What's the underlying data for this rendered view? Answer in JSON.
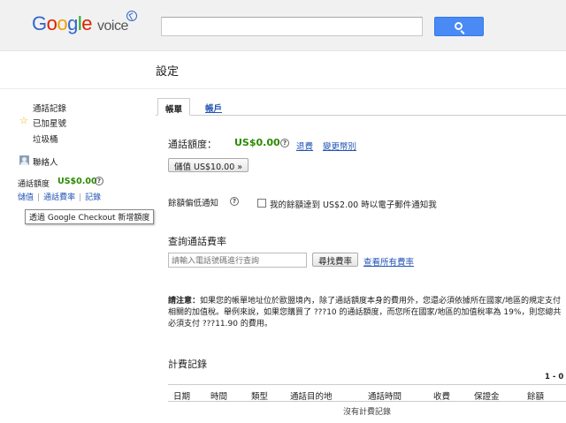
{
  "header": {
    "logo_letters": [
      "G",
      "o",
      "o",
      "g",
      "l",
      "e"
    ],
    "logo_suffix": "voice",
    "search_placeholder": ""
  },
  "page": {
    "title": "設定"
  },
  "sidebar": {
    "items": [
      "通話記錄",
      "已加星號",
      "垃圾桶",
      "聯絡人"
    ],
    "credit_label": "通話額度",
    "credit_value": "US$0.00",
    "links": [
      "儲值",
      "通話費率",
      "記錄"
    ],
    "tooltip": "透過 Google Checkout 新增額度"
  },
  "tabs": [
    "帳單",
    "帳戶"
  ],
  "billing": {
    "credit_label": "通話額度：",
    "credit_value": "US$0.00",
    "links": [
      "退費",
      "變更幣別"
    ],
    "add_credit_button": "儲值 US$10.00 »",
    "low_balance_label": "餘額偏低通知",
    "low_balance_checkbox": "我的餘額達到 US$2.00 時以電子郵件通知我",
    "low_balance_checked": false,
    "rates_heading": "查詢通話費率",
    "rate_input_placeholder": "請輸入電話號碼進行查詢",
    "find_rate_button": "尋找費率",
    "see_all_rates_link": "查看所有費率",
    "notice_label": "請注意：",
    "notice_text": "如果您的帳單地址位於歐盟境內，除了通話額度本身的費用外，您還必須依據所在國家/地區的規定支付相關的加值稅。舉例來說，如果您購買了 ???10 的通話額度，而您所在國家/地區的加值稅率為 19%，則您總共必須支付 ???11.90 的費用。",
    "history_heading": "計費記錄",
    "history_range": "1 - 0",
    "table_headers": [
      "日期",
      "時間",
      "類型",
      "通話目的地",
      "通話時間",
      "收費",
      "保證金",
      "餘額"
    ],
    "empty_text": "沒有計費記錄"
  },
  "colors": {
    "accent_blue": "#4a8af4",
    "link": "#2254b4",
    "credit_green": "#2a8a00"
  }
}
